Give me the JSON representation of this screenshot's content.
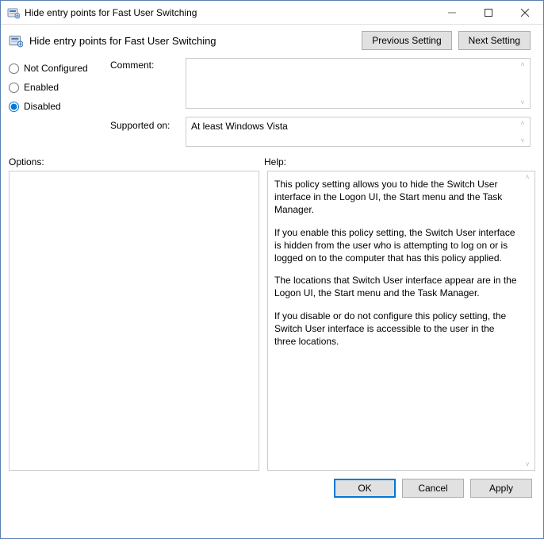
{
  "window": {
    "title": "Hide entry points for Fast User Switching"
  },
  "header": {
    "title": "Hide entry points for Fast User Switching",
    "prev_label": "Previous Setting",
    "next_label": "Next Setting"
  },
  "config": {
    "not_configured_label": "Not Configured",
    "enabled_label": "Enabled",
    "disabled_label": "Disabled",
    "selected": "disabled",
    "comment_label": "Comment:",
    "comment_value": "",
    "supported_label": "Supported on:",
    "supported_value": "At least Windows Vista"
  },
  "sections": {
    "options_label": "Options:",
    "help_label": "Help:"
  },
  "help": {
    "p1": "This policy setting allows you to hide the Switch User interface in the Logon UI, the Start menu and the Task Manager.",
    "p2": "If you enable this policy setting, the Switch User interface is hidden from the user who is attempting to log on or is logged on to the computer that has this policy applied.",
    "p3": "The locations that Switch User interface appear are in the Logon UI, the Start menu and the Task Manager.",
    "p4": "If you disable or do not configure this policy setting, the Switch User interface is accessible to the user in the three locations."
  },
  "footer": {
    "ok_label": "OK",
    "cancel_label": "Cancel",
    "apply_label": "Apply"
  }
}
